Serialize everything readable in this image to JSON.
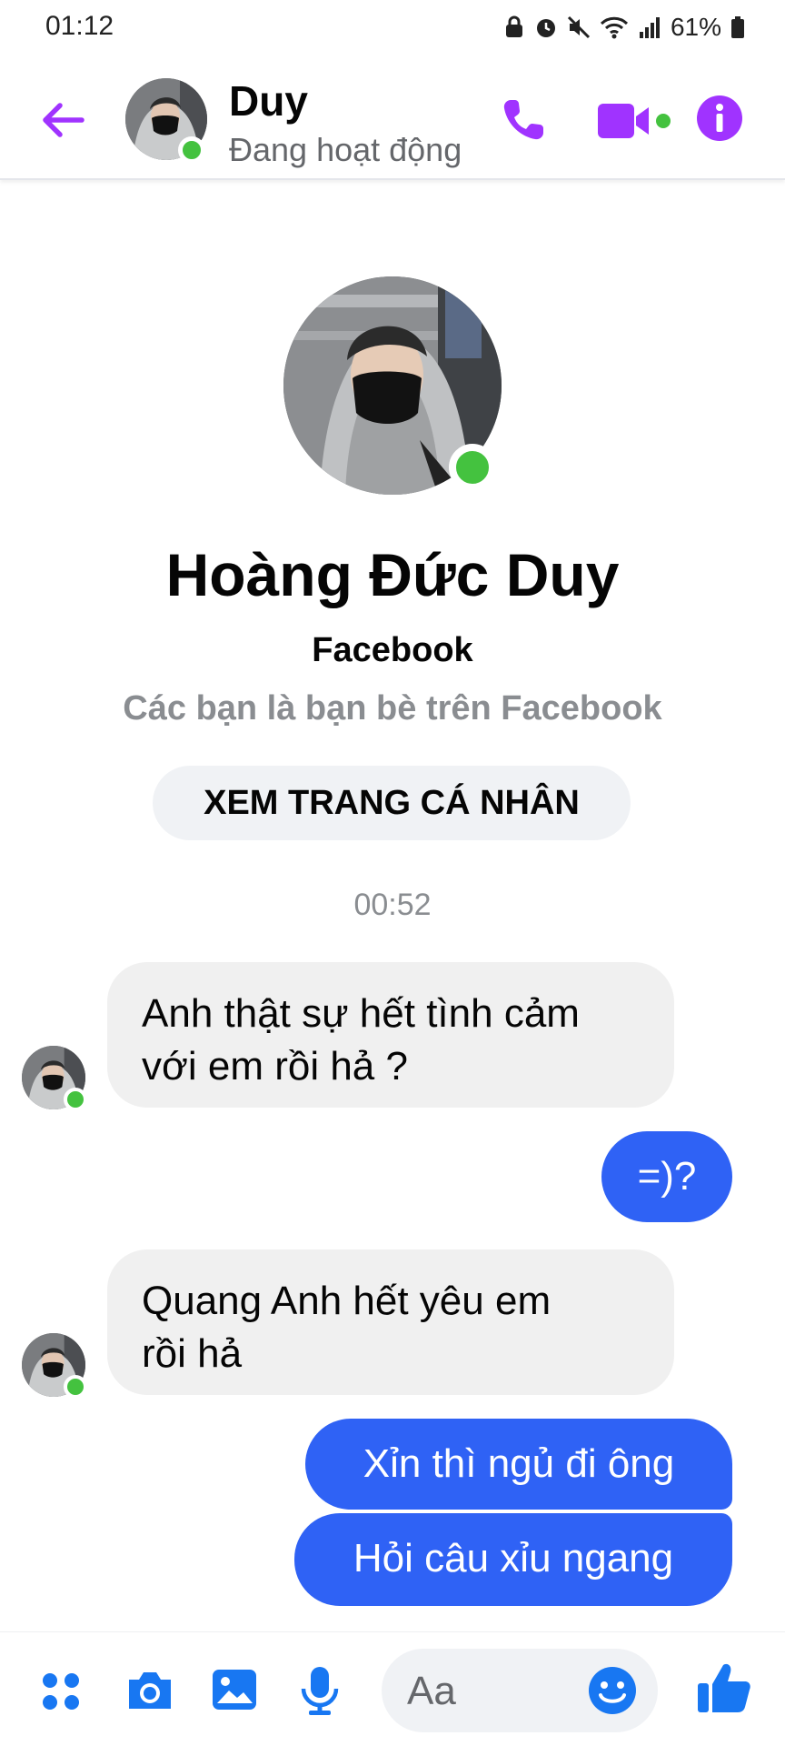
{
  "status_bar": {
    "time": "01:12",
    "battery": "61%"
  },
  "header": {
    "name": "Duy",
    "status": "Đang hoạt động"
  },
  "profile": {
    "full_name": "Hoàng Đức Duy",
    "source": "Facebook",
    "relationship": "Các bạn là bạn bè trên Facebook",
    "view_profile_label": "XEM TRANG CÁ NHÂN"
  },
  "conversation": {
    "timestamp": "00:52",
    "messages": [
      {
        "sender": "them",
        "line1": "Anh thật sự hết tình cảm",
        "line2": "với em rồi hả ?"
      },
      {
        "sender": "me",
        "text": "=)?"
      },
      {
        "sender": "them",
        "line1": "Quang Anh hết yêu em",
        "line2": "rồi hả"
      },
      {
        "sender": "me",
        "text": "Xỉn thì ngủ đi ông"
      },
      {
        "sender": "me",
        "text": "Hỏi câu xỉu ngang"
      }
    ]
  },
  "composer": {
    "placeholder": "Aa"
  },
  "colors": {
    "accent_purple": "#a033ff",
    "outgoing_blue": "#2f62f5",
    "toolbar_blue": "#1877f2",
    "online_green": "#44c23f"
  },
  "icons": [
    "arrow-left-icon",
    "phone-icon",
    "video-camera-icon",
    "info-icon",
    "apps-icon",
    "camera-icon",
    "image-icon",
    "microphone-icon",
    "emoji-icon",
    "thumbs-up-icon"
  ]
}
